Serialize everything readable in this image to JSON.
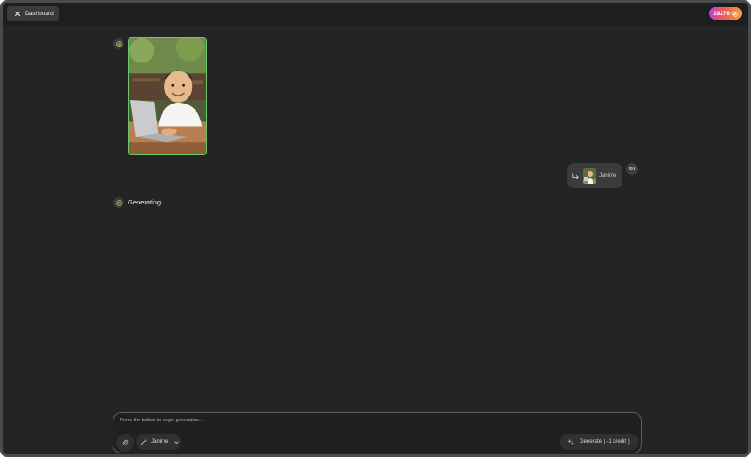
{
  "topbar": {
    "dashboard_label": "Dashboard",
    "credits": "18276"
  },
  "chat": {
    "user_initials": "SU",
    "bubble_label": "Janime",
    "status": "Generating . . ."
  },
  "composer": {
    "prompt_text": "Press the button to begin generation...",
    "style_label": "Janime",
    "generate_label": "Generate ( -1 credit )"
  },
  "colors": {
    "background": "#232425",
    "accent_border": "#6ac76b",
    "credits_gradient": [
      "#c43fd6",
      "#f0604a",
      "#f7a23c"
    ]
  }
}
